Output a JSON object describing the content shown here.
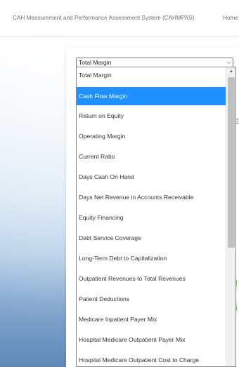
{
  "header": {
    "app_title": "CAH Measurement and Performance Assessment System (CAHMPAS)",
    "home_link": "Home"
  },
  "background": {
    "fragment_1": "E",
    "fragment_2": "I"
  },
  "select": {
    "selected_value": "Total Margin",
    "arrow_icon": "chevron-down-icon"
  },
  "dropdown": {
    "highlighted_index": 1,
    "options": [
      "Total Margin",
      "Cash Flow Margin",
      "Return on Equity",
      "Operating Margin",
      "Current Ratio",
      "Days Cash On Hand",
      "Days Net Revenue in Accounts Receivable",
      "Equity Financing",
      "Debt Service Coverage",
      "Long-Term Debt to Capitalization",
      "Outpatient Revenues to Total Revenues",
      "Patient Deductions",
      "Medicare Inpatient Payer Mix",
      "Hospital Medicare Outpatient Payer Mix",
      "Hospital Medicare Outpatient Cost to Charge"
    ],
    "scroll_up_icon": "triangle-up-icon"
  },
  "colors": {
    "highlight": "#1e90ff",
    "header_text": "#6f6f6f",
    "option_text": "#333333"
  }
}
